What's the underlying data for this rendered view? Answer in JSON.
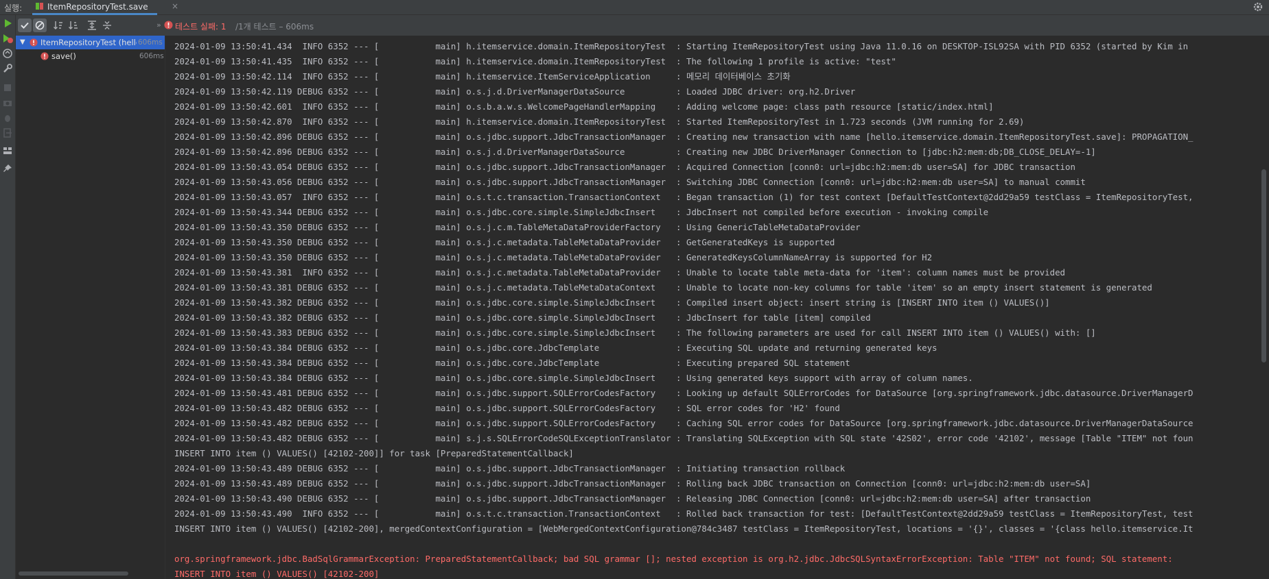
{
  "topbar": {
    "run_label": "실행:",
    "tab_title": "ItemRepositoryTest.save",
    "tab_close": "×"
  },
  "status": {
    "failed": "테스트 실패: 1",
    "rest": "/1개 테스트 – 606ms"
  },
  "tree": {
    "root": {
      "label": "ItemRepositoryTest (hello",
      "time": "606ms"
    },
    "child": {
      "label": "save()",
      "time": "606ms"
    }
  },
  "console": {
    "lines": [
      "2024-01-09 13:50:41.434  INFO 6352 --- [           main] h.itemservice.domain.ItemRepositoryTest  : Starting ItemRepositoryTest using Java 11.0.16 on DESKTOP-ISL92SA with PID 6352 (started by Kim in",
      "2024-01-09 13:50:41.435  INFO 6352 --- [           main] h.itemservice.domain.ItemRepositoryTest  : The following 1 profile is active: \"test\"",
      "2024-01-09 13:50:42.114  INFO 6352 --- [           main] h.itemservice.ItemServiceApplication     : 메모리 데이터베이스 초기화",
      "2024-01-09 13:50:42.119 DEBUG 6352 --- [           main] o.s.j.d.DriverManagerDataSource          : Loaded JDBC driver: org.h2.Driver",
      "2024-01-09 13:50:42.601  INFO 6352 --- [           main] o.s.b.a.w.s.WelcomePageHandlerMapping    : Adding welcome page: class path resource [static/index.html]",
      "2024-01-09 13:50:42.870  INFO 6352 --- [           main] h.itemservice.domain.ItemRepositoryTest  : Started ItemRepositoryTest in 1.723 seconds (JVM running for 2.69)",
      "2024-01-09 13:50:42.896 DEBUG 6352 --- [           main] o.s.jdbc.support.JdbcTransactionManager  : Creating new transaction with name [hello.itemservice.domain.ItemRepositoryTest.save]: PROPAGATION_",
      "2024-01-09 13:50:42.896 DEBUG 6352 --- [           main] o.s.j.d.DriverManagerDataSource          : Creating new JDBC DriverManager Connection to [jdbc:h2:mem:db;DB_CLOSE_DELAY=-1]",
      "2024-01-09 13:50:43.054 DEBUG 6352 --- [           main] o.s.jdbc.support.JdbcTransactionManager  : Acquired Connection [conn0: url=jdbc:h2:mem:db user=SA] for JDBC transaction",
      "2024-01-09 13:50:43.056 DEBUG 6352 --- [           main] o.s.jdbc.support.JdbcTransactionManager  : Switching JDBC Connection [conn0: url=jdbc:h2:mem:db user=SA] to manual commit",
      "2024-01-09 13:50:43.057  INFO 6352 --- [           main] o.s.t.c.transaction.TransactionContext   : Began transaction (1) for test context [DefaultTestContext@2dd29a59 testClass = ItemRepositoryTest,",
      "2024-01-09 13:50:43.344 DEBUG 6352 --- [           main] o.s.jdbc.core.simple.SimpleJdbcInsert    : JdbcInsert not compiled before execution - invoking compile",
      "2024-01-09 13:50:43.350 DEBUG 6352 --- [           main] o.s.j.c.m.TableMetaDataProviderFactory   : Using GenericTableMetaDataProvider",
      "2024-01-09 13:50:43.350 DEBUG 6352 --- [           main] o.s.j.c.metadata.TableMetaDataProvider   : GetGeneratedKeys is supported",
      "2024-01-09 13:50:43.350 DEBUG 6352 --- [           main] o.s.j.c.metadata.TableMetaDataProvider   : GeneratedKeysColumnNameArray is supported for H2",
      "2024-01-09 13:50:43.381  INFO 6352 --- [           main] o.s.j.c.metadata.TableMetaDataProvider   : Unable to locate table meta-data for 'item': column names must be provided",
      "2024-01-09 13:50:43.381 DEBUG 6352 --- [           main] o.s.j.c.metadata.TableMetaDataContext    : Unable to locate non-key columns for table 'item' so an empty insert statement is generated",
      "2024-01-09 13:50:43.382 DEBUG 6352 --- [           main] o.s.jdbc.core.simple.SimpleJdbcInsert    : Compiled insert object: insert string is [INSERT INTO item () VALUES()]",
      "2024-01-09 13:50:43.382 DEBUG 6352 --- [           main] o.s.jdbc.core.simple.SimpleJdbcInsert    : JdbcInsert for table [item] compiled",
      "2024-01-09 13:50:43.383 DEBUG 6352 --- [           main] o.s.jdbc.core.simple.SimpleJdbcInsert    : The following parameters are used for call INSERT INTO item () VALUES() with: []",
      "2024-01-09 13:50:43.384 DEBUG 6352 --- [           main] o.s.jdbc.core.JdbcTemplate               : Executing SQL update and returning generated keys",
      "2024-01-09 13:50:43.384 DEBUG 6352 --- [           main] o.s.jdbc.core.JdbcTemplate               : Executing prepared SQL statement",
      "2024-01-09 13:50:43.384 DEBUG 6352 --- [           main] o.s.jdbc.core.simple.SimpleJdbcInsert    : Using generated keys support with array of column names.",
      "2024-01-09 13:50:43.481 DEBUG 6352 --- [           main] o.s.jdbc.support.SQLErrorCodesFactory    : Looking up default SQLErrorCodes for DataSource [org.springframework.jdbc.datasource.DriverManagerD",
      "2024-01-09 13:50:43.482 DEBUG 6352 --- [           main] o.s.jdbc.support.SQLErrorCodesFactory    : SQL error codes for 'H2' found",
      "2024-01-09 13:50:43.482 DEBUG 6352 --- [           main] o.s.jdbc.support.SQLErrorCodesFactory    : Caching SQL error codes for DataSource [org.springframework.jdbc.datasource.DriverManagerDataSource",
      "2024-01-09 13:50:43.482 DEBUG 6352 --- [           main] s.j.s.SQLErrorCodeSQLExceptionTranslator : Translating SQLException with SQL state '42S02', error code '42102', message [Table \"ITEM\" not foun",
      "INSERT INTO item () VALUES() [42102-200]] for task [PreparedStatementCallback]",
      "2024-01-09 13:50:43.489 DEBUG 6352 --- [           main] o.s.jdbc.support.JdbcTransactionManager  : Initiating transaction rollback",
      "2024-01-09 13:50:43.489 DEBUG 6352 --- [           main] o.s.jdbc.support.JdbcTransactionManager  : Rolling back JDBC transaction on Connection [conn0: url=jdbc:h2:mem:db user=SA]",
      "2024-01-09 13:50:43.490 DEBUG 6352 --- [           main] o.s.jdbc.support.JdbcTransactionManager  : Releasing JDBC Connection [conn0: url=jdbc:h2:mem:db user=SA] after transaction",
      "2024-01-09 13:50:43.490  INFO 6352 --- [           main] o.s.t.c.transaction.TransactionContext   : Rolled back transaction for test: [DefaultTestContext@2dd29a59 testClass = ItemRepositoryTest, test",
      "INSERT INTO item () VALUES() [42102-200], mergedContextConfiguration = [WebMergedContextConfiguration@784c3487 testClass = ItemRepositoryTest, locations = '{}', classes = '{class hello.itemservice.It",
      "",
      "org.springframework.jdbc.BadSqlGrammarException: PreparedStatementCallback; bad SQL grammar []; nested exception is org.h2.jdbc.JdbcSQLSyntaxErrorException: Table \"ITEM\" not found; SQL statement:",
      "INSERT INTO item () VALUES() [42102-200]"
    ],
    "error_lines": [
      34,
      35
    ]
  },
  "colors": {
    "error": "#ff6b68",
    "selection": "#2f65ca",
    "run_green": "#5fb832"
  }
}
